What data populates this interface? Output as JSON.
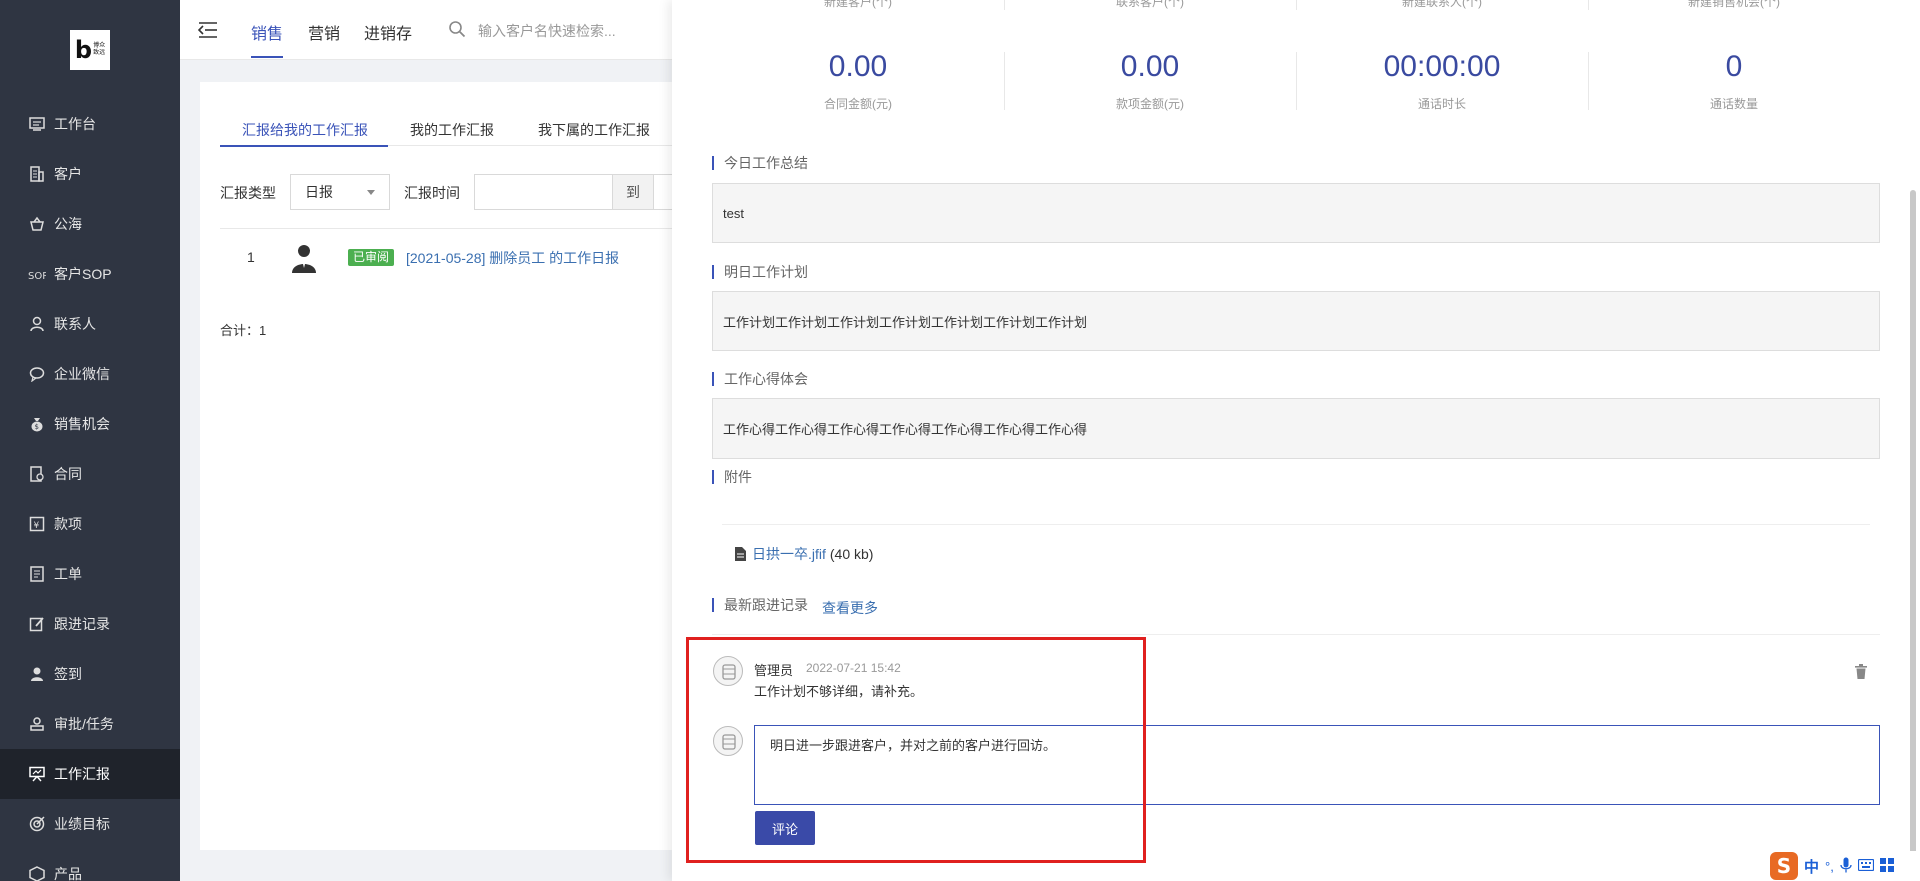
{
  "logo": {
    "text_line1": "博众",
    "text_line2": "致远"
  },
  "sidebar": {
    "items": [
      {
        "label": "工作台",
        "icon": "desktop-icon"
      },
      {
        "label": "客户",
        "icon": "building-icon"
      },
      {
        "label": "公海",
        "icon": "basket-icon"
      },
      {
        "label": "客户SOP",
        "icon": "sop-icon"
      },
      {
        "label": "联系人",
        "icon": "person-icon"
      },
      {
        "label": "企业微信",
        "icon": "chat-icon"
      },
      {
        "label": "销售机会",
        "icon": "moneybag-icon"
      },
      {
        "label": "合同",
        "icon": "contract-icon"
      },
      {
        "label": "款项",
        "icon": "yen-icon"
      },
      {
        "label": "工单",
        "icon": "ticket-icon"
      },
      {
        "label": "跟进记录",
        "icon": "edit-icon"
      },
      {
        "label": "签到",
        "icon": "checkin-icon"
      },
      {
        "label": "审批/任务",
        "icon": "approval-icon"
      },
      {
        "label": "工作汇报",
        "icon": "presentation-icon",
        "active": true
      },
      {
        "label": "业绩目标",
        "icon": "target-icon"
      },
      {
        "label": "产品",
        "icon": "product-icon"
      }
    ]
  },
  "topbar": {
    "tabs": [
      {
        "label": "销售",
        "active": true
      },
      {
        "label": "营销"
      },
      {
        "label": "进销存"
      }
    ],
    "search_placeholder": "输入客户名快速检索..."
  },
  "report_list": {
    "sub_tabs": [
      {
        "label": "汇报给我的工作汇报",
        "active": true
      },
      {
        "label": "我的工作汇报"
      },
      {
        "label": "我下属的工作汇报"
      }
    ],
    "filter": {
      "type_label": "汇报类型",
      "type_value": "日报",
      "time_label": "汇报时间",
      "to_label": "到"
    },
    "rows": [
      {
        "index": "1",
        "status": "已审阅",
        "title": "[2021-05-28] 删除员工 的工作日报"
      }
    ],
    "total": "合计：1"
  },
  "drawer": {
    "stats_top_labels": [
      "新建客户(个)",
      "联系客户(个)",
      "新建联系人(个)",
      "新建销售机会(个)"
    ],
    "stats": [
      {
        "value": "0.00",
        "label": "合同金额(元)"
      },
      {
        "value": "0.00",
        "label": "款项金额(元)"
      },
      {
        "value": "00:00:00",
        "label": "通话时长"
      },
      {
        "value": "0",
        "label": "通话数量"
      }
    ],
    "sections": {
      "summary_title": "今日工作总结",
      "summary_text": "test",
      "plan_title": "明日工作计划",
      "plan_text": "工作计划工作计划工作计划工作计划工作计划工作计划工作计划",
      "insight_title": "工作心得体会",
      "insight_text": "工作心得工作心得工作心得工作心得工作心得工作心得工作心得",
      "attachment_title": "附件",
      "attachment_name": "日拱一卒.jfif",
      "attachment_size": "(40 kb)",
      "followup_title": "最新跟进记录",
      "more_link": "查看更多"
    },
    "comment": {
      "author": "管理员",
      "time": "2022-07-21 15:42",
      "text": "工作计划不够详细，请补充。"
    },
    "reply": {
      "value": "明日进一步跟进客户，并对之前的客户进行回访。",
      "button_label": "评论"
    }
  },
  "ime": {
    "mode": "中",
    "punct": "°,"
  },
  "colors": {
    "accent": "#3a53b8",
    "sidebar_bg": "#2f3542",
    "highlight": "#e0201f",
    "badge": "#4caf50"
  }
}
